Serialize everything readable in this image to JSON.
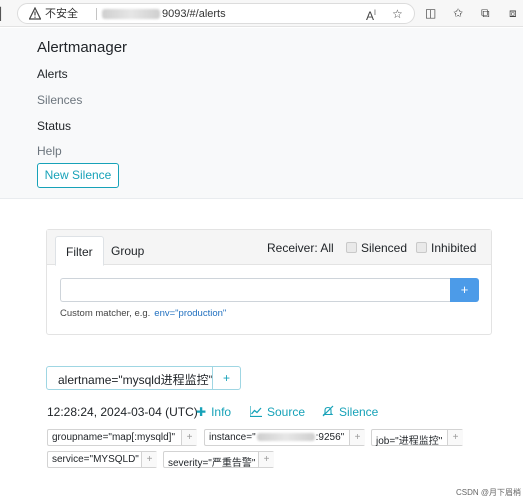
{
  "browser": {
    "insecure_label": "不安全",
    "url": "9093/#/alerts",
    "icons": [
      "warning-icon",
      "read-aloud-icon",
      "favorite-icon",
      "split-screen-icon",
      "favorites-icon",
      "collections-icon",
      "more-icon"
    ]
  },
  "nav": {
    "brand": "Alertmanager",
    "links": [
      "Alerts",
      "Silences",
      "Status",
      "Help"
    ],
    "new_silence": "New Silence"
  },
  "filter": {
    "tabs": [
      "Filter",
      "Group"
    ],
    "receiver": "Receiver: All",
    "silenced": "Silenced",
    "inhibited": "Inhibited",
    "input_value": "",
    "add_button": "+",
    "hint_prefix": "Custom matcher, e.g.",
    "hint_example": "env=\"production\""
  },
  "active_filter": {
    "label": "alertname=\"mysqld进程监控\"",
    "plus": "+"
  },
  "alert": {
    "time": "12:28:24, 2024-03-04 (UTC)",
    "info": "Info",
    "source": "Source",
    "silence": "Silence",
    "labels": {
      "groupname": "groupname=\"map[:mysqld]\"",
      "instance_prefix": "instance=\"",
      "instance_suffix": ":9256\"",
      "job": "job=\"进程监控\"",
      "service": "service=\"MYSQLD\"",
      "severity": "severity=\"严重告警\""
    },
    "plus": "+"
  },
  "watermark": "CSDN @月下眉梢"
}
